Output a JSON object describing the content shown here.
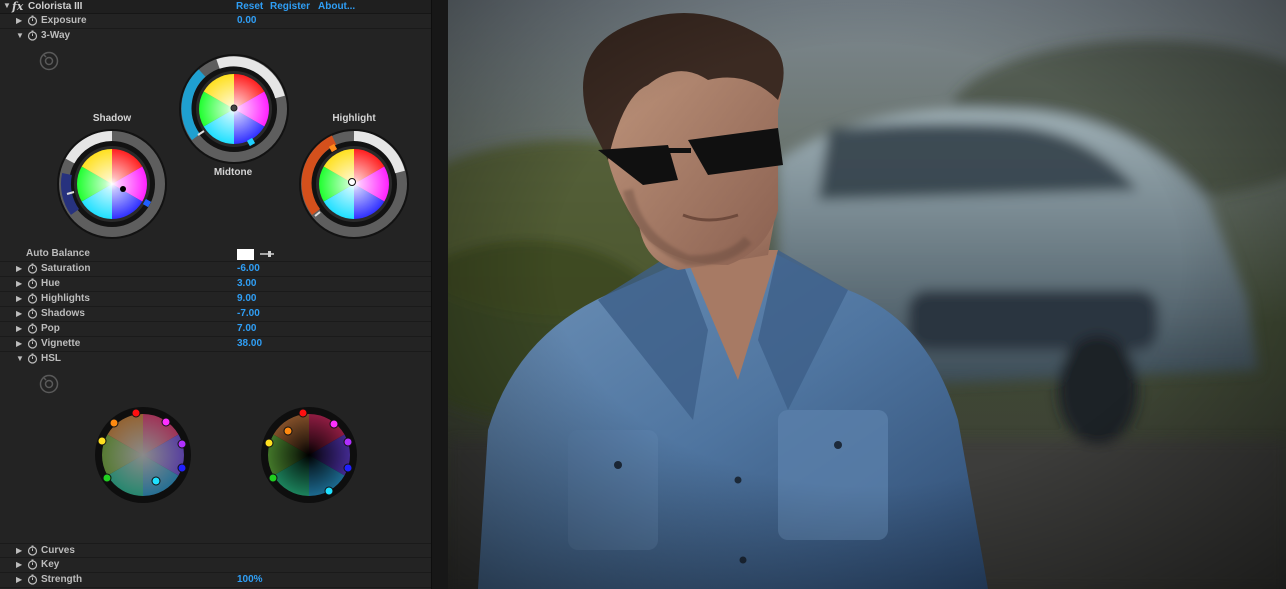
{
  "effect": {
    "title": "Colorista III",
    "fx_label": "fx",
    "links": [
      "Reset",
      "Register",
      "About..."
    ]
  },
  "exposure": {
    "label": "Exposure",
    "value": "0.00"
  },
  "three_way": {
    "label": "3-Way",
    "wheels": [
      {
        "name": "Shadow"
      },
      {
        "name": "Midtone"
      },
      {
        "name": "Highlight"
      }
    ]
  },
  "auto_balance": {
    "label": "Auto Balance",
    "swatch_color": "#ffffff"
  },
  "params": [
    {
      "label": "Saturation",
      "value": "-6.00"
    },
    {
      "label": "Hue",
      "value": "3.00"
    },
    {
      "label": "Highlights",
      "value": "9.00"
    },
    {
      "label": "Shadows",
      "value": "-7.00"
    },
    {
      "label": "Pop",
      "value": "7.00"
    },
    {
      "label": "Vignette",
      "value": "38.00"
    }
  ],
  "hsl": {
    "label": "HSL"
  },
  "bottom_rows": [
    {
      "label": "Curves",
      "value": ""
    },
    {
      "label": "Key",
      "value": ""
    },
    {
      "label": "Strength",
      "value": "100%"
    }
  ],
  "colors": {
    "accent_value": "#2f9ef5",
    "panel_bg": "#232323",
    "title_bg": "#1f1f1f"
  },
  "icons": {
    "expand": "triangle-down",
    "collapse": "triangle-right",
    "stopwatch": "stopwatch-icon",
    "reset": "reset-circle-icon",
    "eyedropper": "eyedropper-icon"
  }
}
